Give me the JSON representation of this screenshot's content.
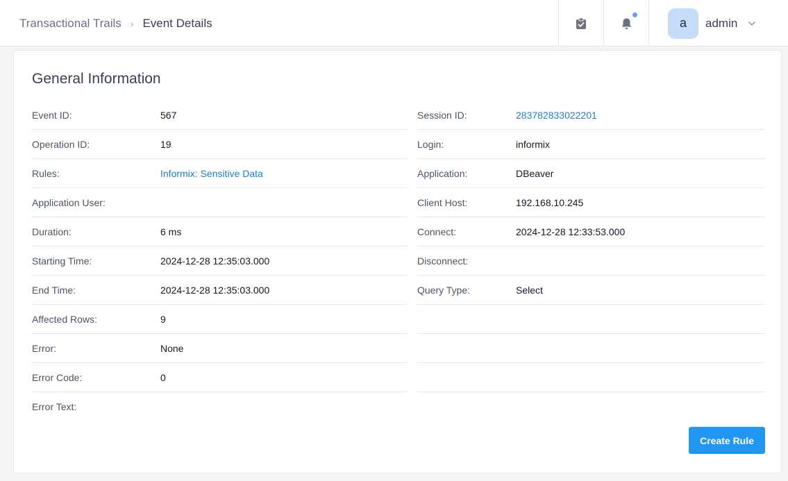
{
  "breadcrumb": {
    "root": "Transactional Trails",
    "separator": "›",
    "current": "Event Details"
  },
  "header": {
    "tasks_icon": "clipboard-check-icon",
    "notifications_icon": "bell-icon",
    "notification_dot_color": "#60a5fa",
    "user": {
      "avatar_letter": "a",
      "name": "admin"
    }
  },
  "card": {
    "title": "General Information",
    "left_rows": [
      {
        "label": "Event ID:",
        "value": "567"
      },
      {
        "label": "Operation ID:",
        "value": "19"
      },
      {
        "label": "Rules:",
        "value": "Informix: Sensitive Data",
        "link": true
      },
      {
        "label": "Application User:",
        "value": ""
      },
      {
        "label": "Duration:",
        "value": "6 ms"
      },
      {
        "label": "Starting Time:",
        "value": "2024-12-28 12:35:03.000"
      },
      {
        "label": "End Time:",
        "value": "2024-12-28 12:35:03.000"
      },
      {
        "label": "Affected Rows:",
        "value": "9"
      },
      {
        "label": "Error:",
        "value": "None"
      },
      {
        "label": "Error Code:",
        "value": "0"
      },
      {
        "label": "Error Text:",
        "value": ""
      }
    ],
    "right_rows": [
      {
        "label": "Session ID:",
        "value": "283782833022201",
        "link": true
      },
      {
        "label": "Login:",
        "value": "informix"
      },
      {
        "label": "Application:",
        "value": "DBeaver"
      },
      {
        "label": "Client Host:",
        "value": "192.168.10.245"
      },
      {
        "label": "Connect:",
        "value": "2024-12-28 12:33:53.000"
      },
      {
        "label": "Disconnect:",
        "value": ""
      },
      {
        "label": "Query Type:",
        "value": "Select"
      }
    ],
    "create_rule_label": "Create Rule"
  },
  "colors": {
    "link": "#1f7fc8",
    "primary_button": "#2196f3",
    "avatar_bg": "#c6dcfb"
  }
}
